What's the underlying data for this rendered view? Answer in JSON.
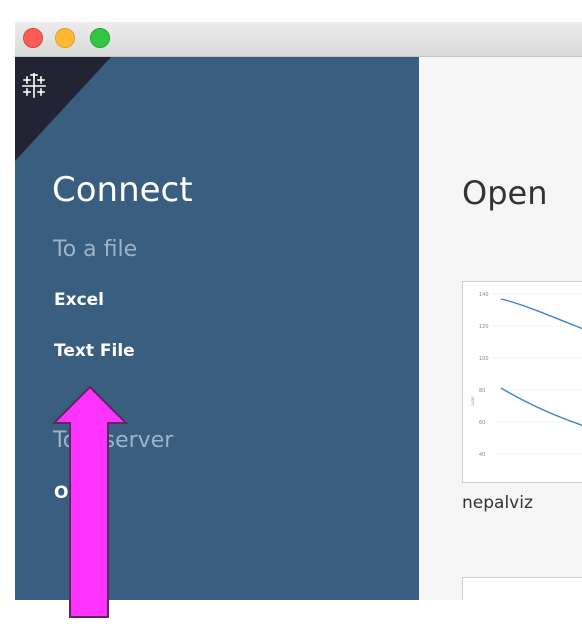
{
  "sidebar": {
    "connect_title": "Connect",
    "to_file_heading": "To a file",
    "excel_label": "Excel",
    "text_file_label": "Text File",
    "to_server_heading": "To a server",
    "server_item_label": "O",
    "logo_icon": "tableau-logo-icon"
  },
  "main": {
    "open_title": "Open",
    "workbooks": [
      {
        "name": "nepalviz"
      }
    ],
    "thumbnail_chart": {
      "y_ticks": [
        "140",
        "120",
        "100",
        "80",
        "60",
        "40"
      ],
      "y_axis_label": "Loan"
    }
  },
  "annotation": {
    "arrow_color": "#ff33ff",
    "arrow_stroke": "#5a2a5a"
  },
  "colors": {
    "sidebar_bg": "#395e80",
    "corner_bg": "#222433",
    "section_heading": "#9db3c8",
    "chart_line": "#3a86c8"
  }
}
